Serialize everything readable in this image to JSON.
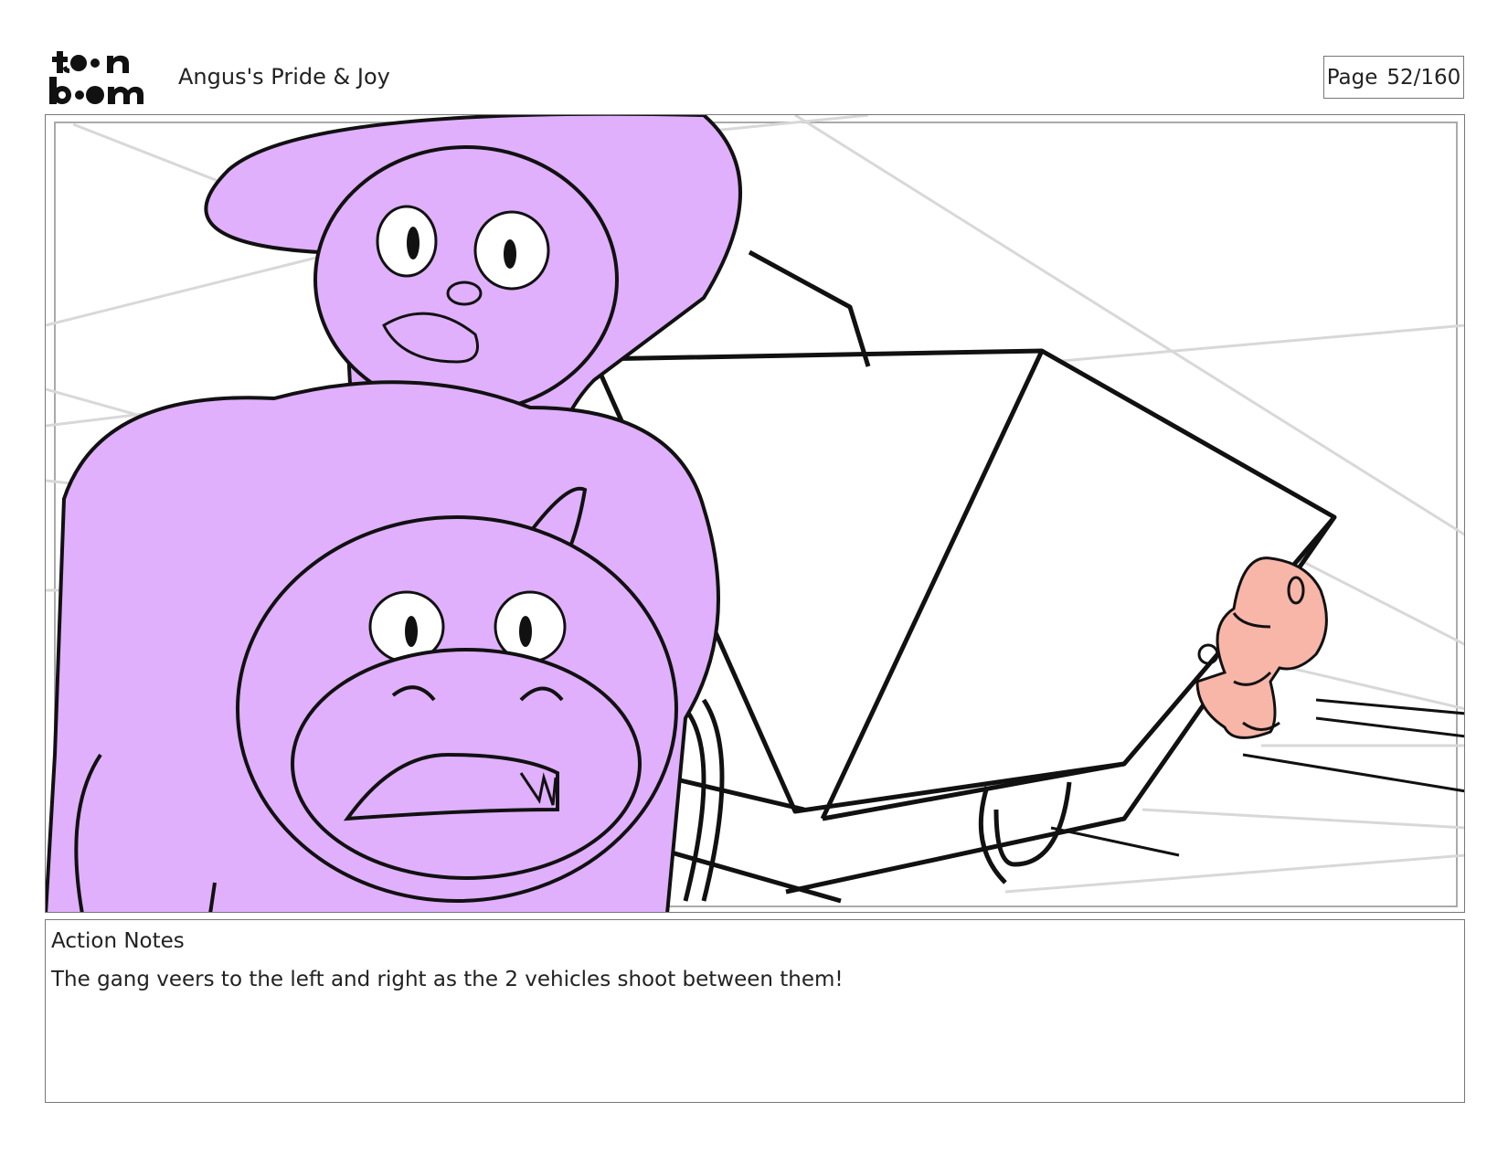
{
  "header": {
    "logo_text": "toonboom",
    "project_title": "Angus's Pride & Joy",
    "page_label": "Page",
    "page_value": "52/160"
  },
  "panel": {
    "colors": {
      "purple_fill": "#e0b0fc",
      "pink_fill": "#f8b6a8",
      "ink": "#111111",
      "speed_lines": "#d8d8d8"
    }
  },
  "notes": {
    "label": "Action Notes",
    "text": "The gang veers to the left and right as the 2 vehicles shoot between them!"
  }
}
